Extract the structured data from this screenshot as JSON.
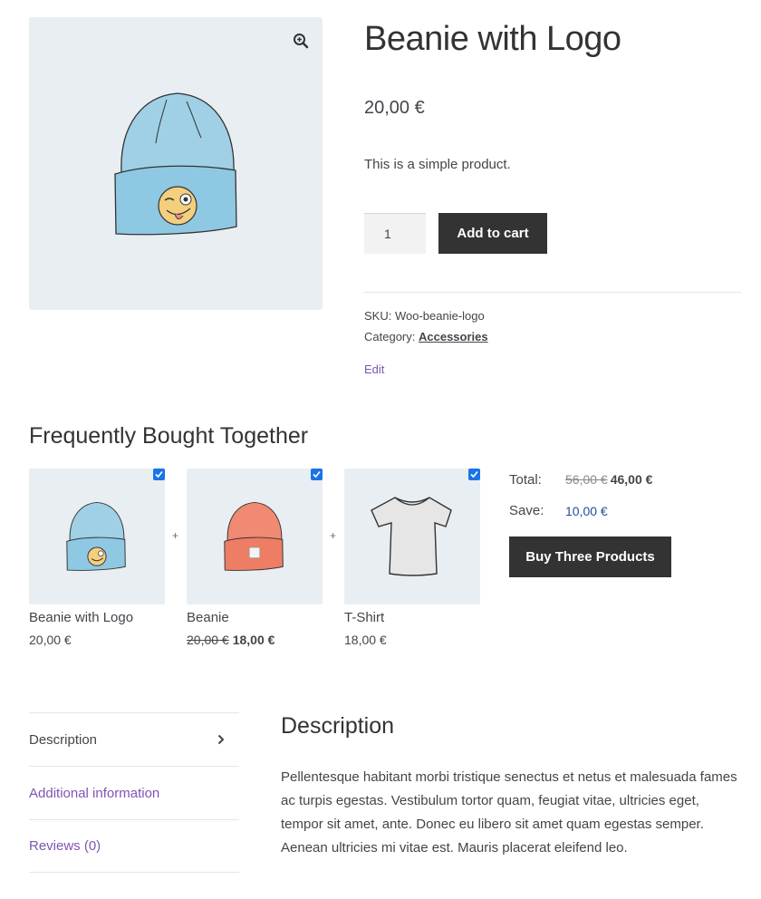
{
  "product": {
    "title": "Beanie with Logo",
    "price": "20,00 €",
    "short_description": "This is a simple product.",
    "quantity": "1",
    "add_to_cart_label": "Add to cart",
    "sku_label": "SKU:",
    "sku_value": "Woo-beanie-logo",
    "category_label": "Category:",
    "category_value": "Accessories",
    "edit_label": "Edit"
  },
  "fbt": {
    "title": "Frequently Bought Together",
    "items": [
      {
        "name": "Beanie with Logo",
        "price": "20,00 €",
        "old_price": "",
        "checked": true
      },
      {
        "name": "Beanie",
        "price": "18,00 €",
        "old_price": "20,00 €",
        "checked": true
      },
      {
        "name": "T-Shirt",
        "price": "18,00 €",
        "old_price": "",
        "checked": true
      }
    ],
    "plus": "+",
    "total_label": "Total:",
    "total_old": "56,00 €",
    "total_new": "46,00 €",
    "save_label": "Save:",
    "save_value": "10,00 €",
    "buy_label": "Buy Three Products"
  },
  "tabs": {
    "items": [
      {
        "label": "Description",
        "active": true
      },
      {
        "label": "Additional information",
        "active": false
      },
      {
        "label": "Reviews (0)",
        "active": false
      }
    ],
    "panel_title": "Description",
    "panel_text": "Pellentesque habitant morbi tristique senectus et netus et malesuada fames ac turpis egestas. Vestibulum tortor quam, feugiat vitae, ultricies eget, tempor sit amet, ante. Donec eu libero sit amet quam egestas semper. Aenean ultricies mi vitae est. Mauris placerat eleifend leo."
  },
  "colors": {
    "accent": "#7f54b3",
    "button_bg": "#333333",
    "image_bg": "#e9eef2",
    "beanie_blue": "#9fd0e6",
    "beanie_red": "#f08a72",
    "checkbox": "#1a73e8"
  },
  "icons": {
    "zoom": "magnifier-plus-icon",
    "tab_arrow": "chevron-right-icon",
    "checkbox": "checkbox-checked-icon"
  }
}
